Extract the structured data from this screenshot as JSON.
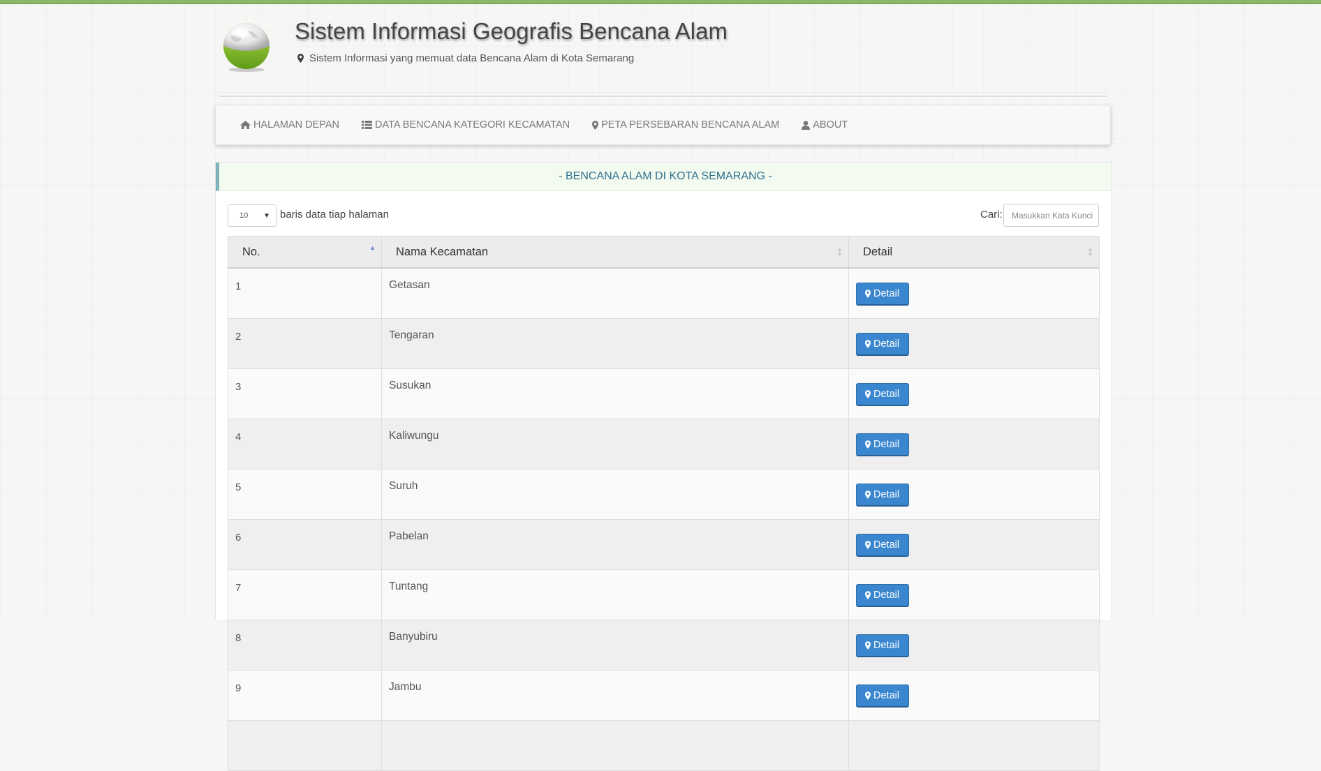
{
  "header": {
    "title": "Sistem Informasi Geografis Bencana Alam",
    "subtitle": "Sistem Informasi yang memuat data Bencana Alam di Kota Semarang"
  },
  "nav": {
    "items": [
      {
        "label": "HALAMAN DEPAN",
        "icon": "home-icon"
      },
      {
        "label": "DATA BENCANA KATEGORI KECAMATAN",
        "icon": "list-icon"
      },
      {
        "label": "PETA PERSEBARAN BENCANA ALAM",
        "icon": "map-marker-icon"
      },
      {
        "label": "ABOUT",
        "icon": "user-icon"
      }
    ]
  },
  "panel": {
    "heading": "- BENCANA ALAM DI KOTA SEMARANG -",
    "length_value": "10",
    "length_label": "baris data tiap halaman",
    "search_label": "Cari:",
    "search_placeholder": "Masukkan Kata Kunci",
    "table": {
      "headers": [
        "No.",
        "Nama Kecamatan",
        "Detail"
      ],
      "sort_column": "No.",
      "rows": [
        {
          "no": "1",
          "name": "Getasan",
          "action": "Detail"
        },
        {
          "no": "2",
          "name": "Tengaran",
          "action": "Detail"
        },
        {
          "no": "3",
          "name": "Susukan",
          "action": "Detail"
        },
        {
          "no": "4",
          "name": "Kaliwungu",
          "action": "Detail"
        },
        {
          "no": "5",
          "name": "Suruh",
          "action": "Detail"
        },
        {
          "no": "6",
          "name": "Pabelan",
          "action": "Detail"
        },
        {
          "no": "7",
          "name": "Tuntang",
          "action": "Detail"
        },
        {
          "no": "8",
          "name": "Banyubiru",
          "action": "Detail"
        },
        {
          "no": "9",
          "name": "Jambu",
          "action": "Detail"
        },
        {
          "no": "",
          "name": "",
          "action": ""
        }
      ]
    }
  },
  "colors": {
    "top_bar": "#8cb86b",
    "panel_heading_text": "#31708f",
    "button": "#3a87cf"
  }
}
